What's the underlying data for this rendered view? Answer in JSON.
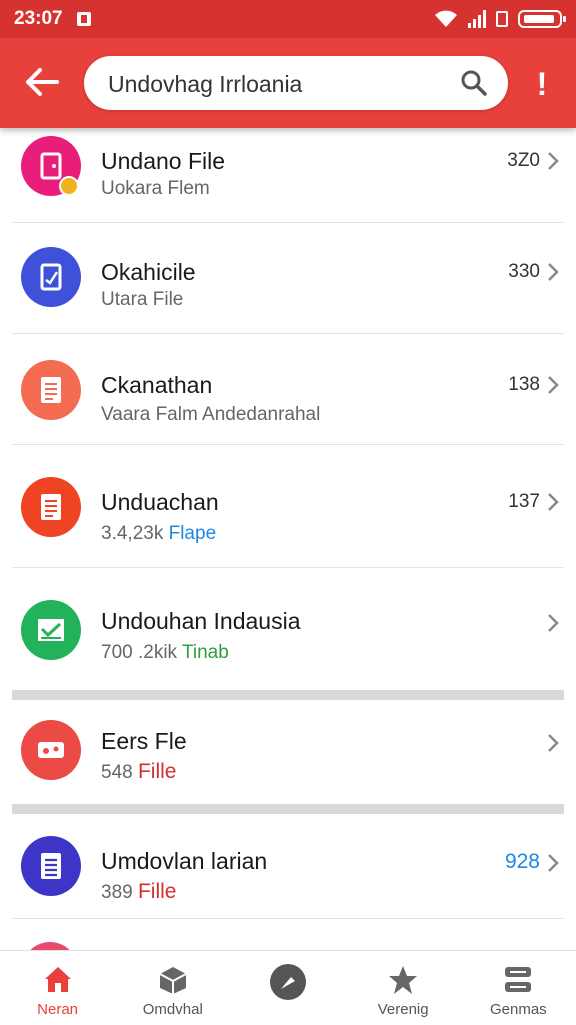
{
  "status": {
    "time": "23:07"
  },
  "search": {
    "value": "Undovhag Irrloania"
  },
  "colors": {
    "primary": "#e8403a",
    "status_bar": "#d6322f",
    "accent_blue": "#1e88e5",
    "accent_green": "#2e9e3e",
    "accent_red": "#d32f2f"
  },
  "list": [
    {
      "title": "Undano File",
      "subtitle": "Uokara Flem",
      "subtitle_accent": "",
      "meta": "3Z0",
      "icon": "document-pink-icon",
      "color": "#e91e7b"
    },
    {
      "title": "Okahicile",
      "subtitle": "Utara File",
      "subtitle_accent": "",
      "meta": "330",
      "icon": "edit-document-icon",
      "color": "#3f51d9"
    },
    {
      "title": "Ckanathan",
      "subtitle": "Vaara Falm Andedanrahal",
      "subtitle_accent": "",
      "meta": "138",
      "icon": "text-document-icon",
      "color": "#f36b50"
    },
    {
      "title": "Unduachan",
      "subtitle": "3.4,23k",
      "subtitle_accent": "Flape",
      "meta": "137",
      "icon": "file-lines-icon",
      "color": "#ef4423"
    },
    {
      "title": "Undouhan Indausia",
      "subtitle": "700 .2kik",
      "subtitle_accent": "Tinab",
      "meta": "",
      "icon": "chart-icon",
      "color": "#22b25a"
    },
    {
      "title": "Eers Fle",
      "subtitle": "548",
      "subtitle_accent": "Fille",
      "meta": "",
      "icon": "media-icon",
      "color": "#ec4a44"
    },
    {
      "title": "Umdovlan larian",
      "subtitle": "389",
      "subtitle_accent": "Fille",
      "meta": "928",
      "icon": "list-document-icon",
      "color": "#3d35c8"
    }
  ],
  "nav": [
    {
      "label": "Neran",
      "icon": "home-icon"
    },
    {
      "label": "Omdvhal",
      "icon": "box-icon"
    },
    {
      "label": "",
      "icon": "compass-icon"
    },
    {
      "label": "Verenig",
      "icon": "star-icon"
    },
    {
      "label": "Genmas",
      "icon": "server-icon"
    }
  ]
}
